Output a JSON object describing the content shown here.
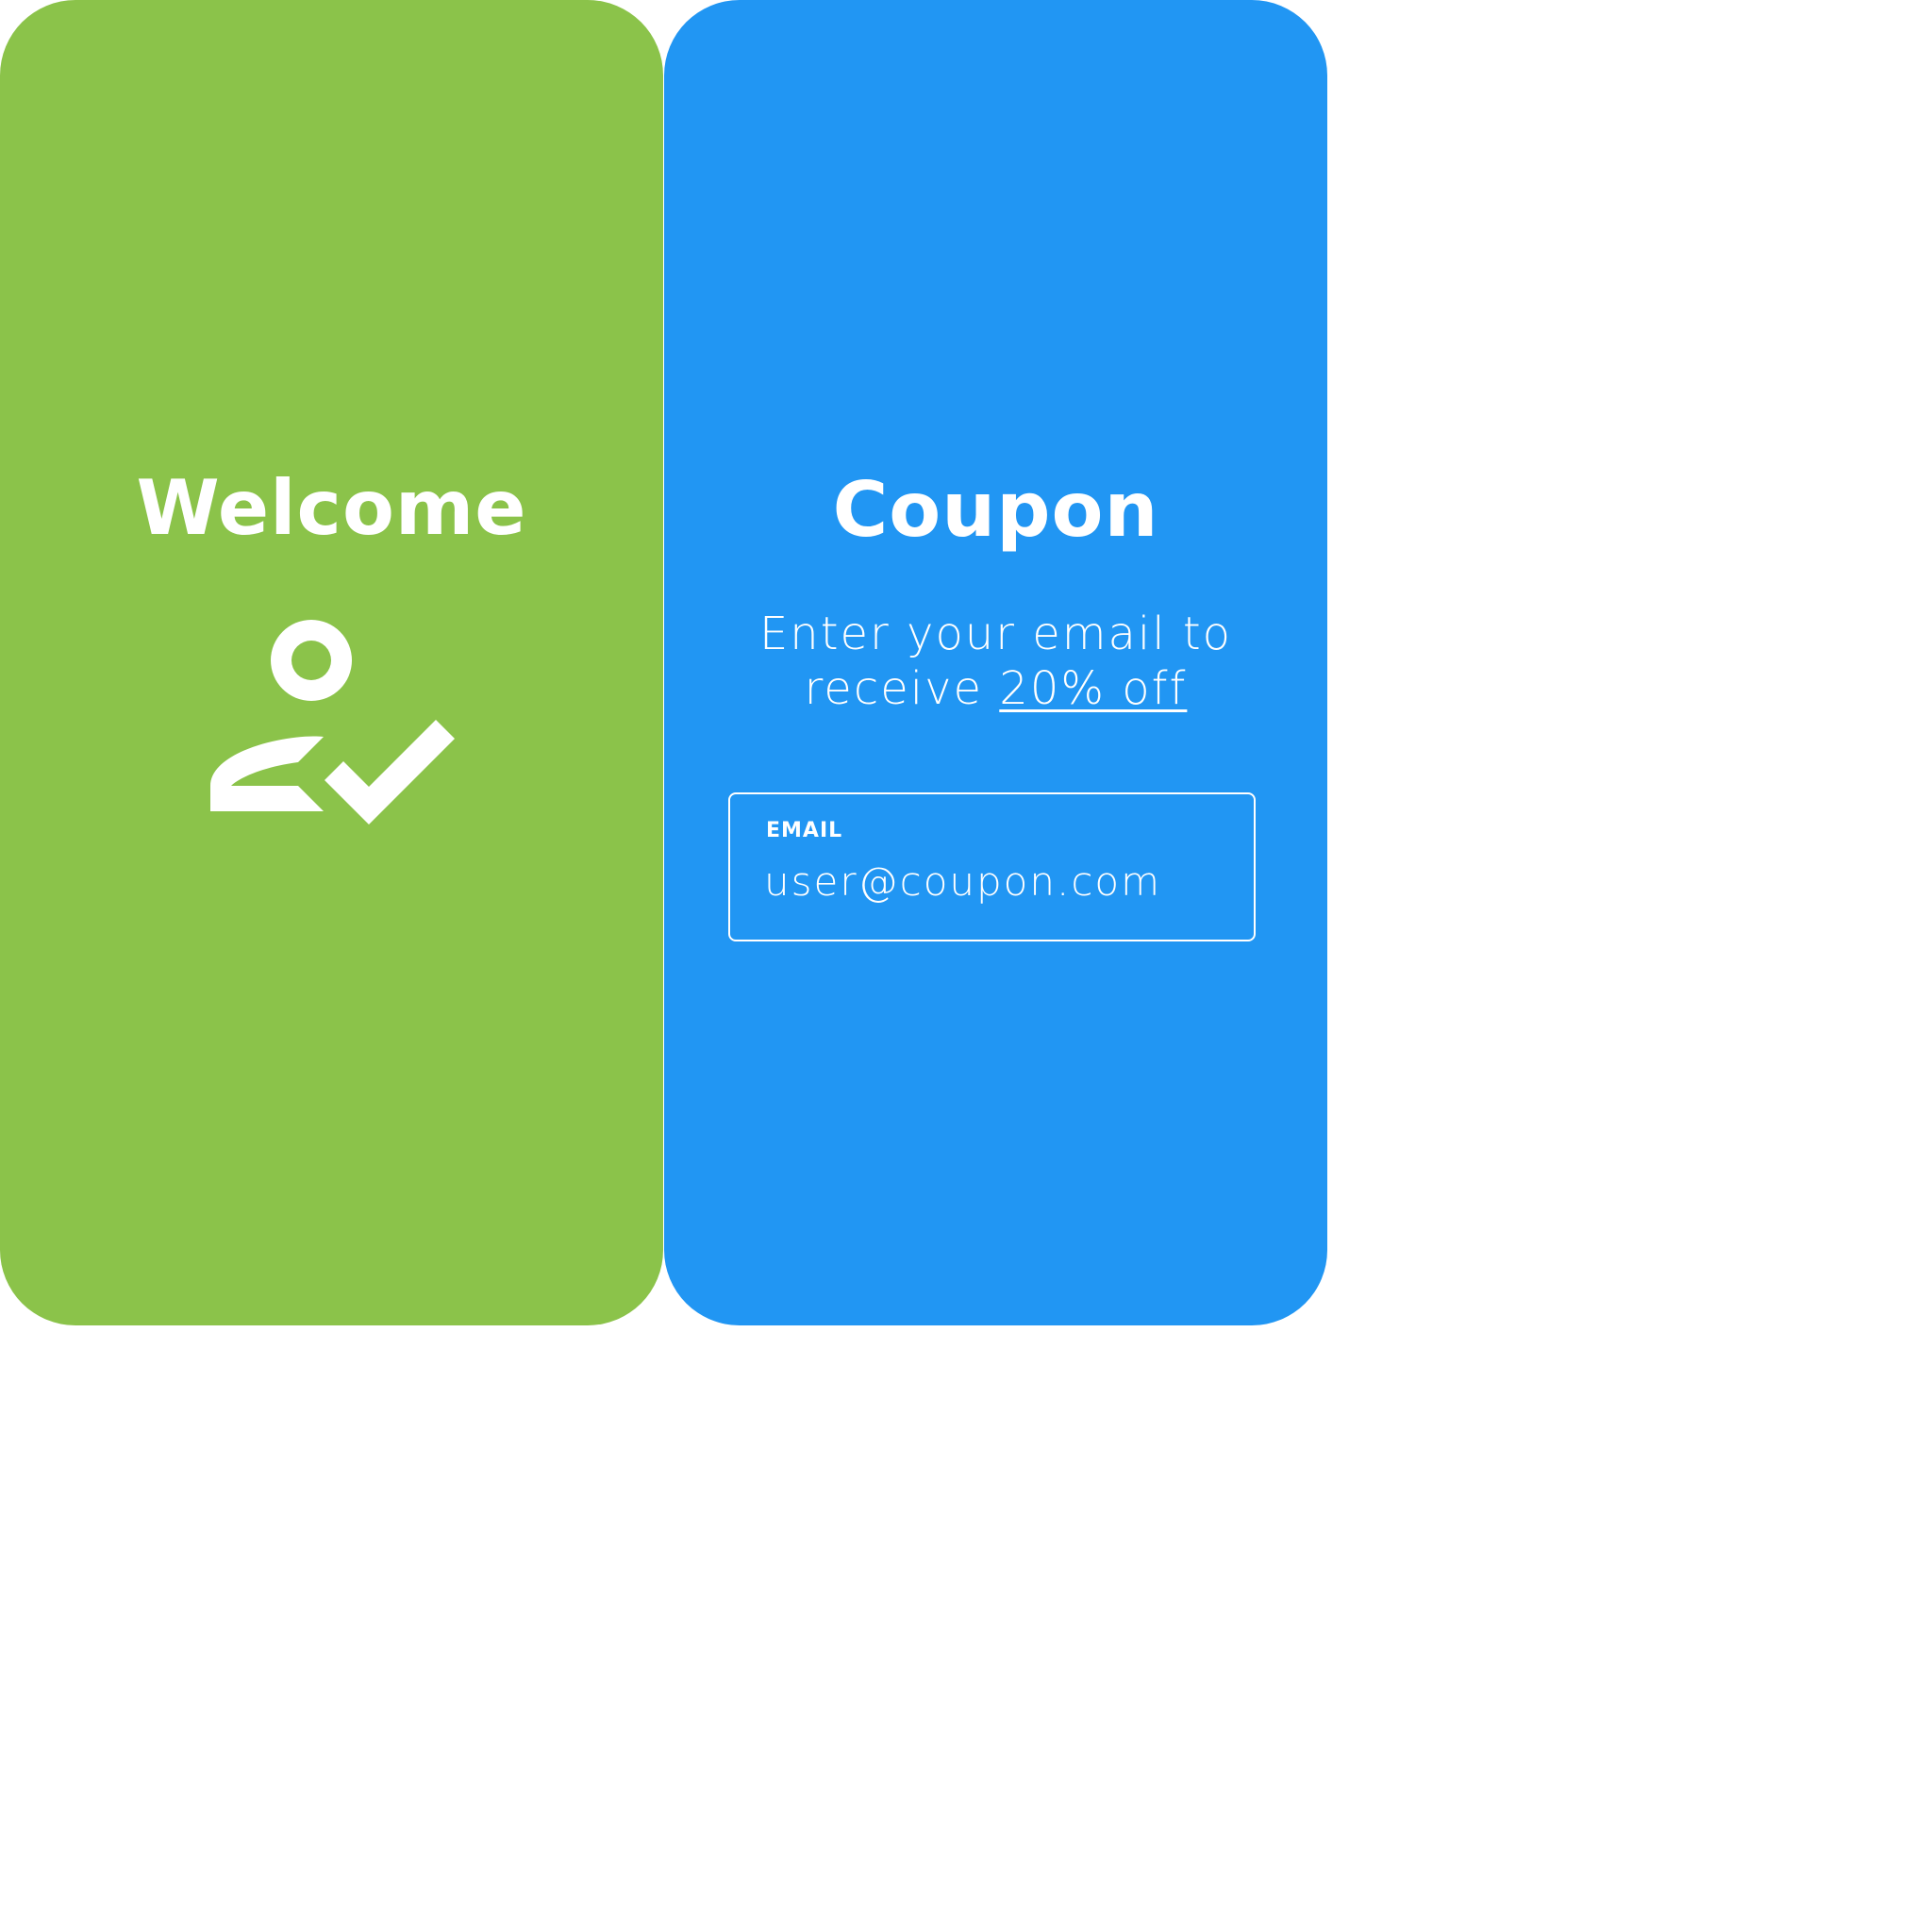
{
  "cards": {
    "welcome": {
      "title": "Welcome",
      "icon": "user-check-icon",
      "color": "#8bc34a"
    },
    "coupon": {
      "title": "Coupon",
      "subtitle_line1": "Enter your email to",
      "subtitle_prefix": "receive",
      "subtitle_highlight": "20% off",
      "color": "#2196f3",
      "email_field": {
        "label": "EMAIL",
        "placeholder": "user@coupon.com",
        "value": ""
      }
    }
  }
}
